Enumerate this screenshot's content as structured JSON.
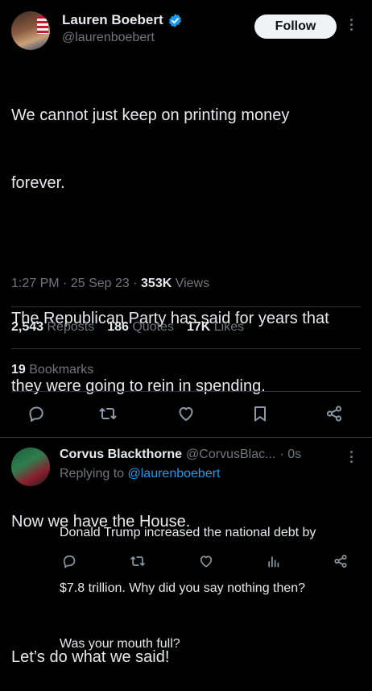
{
  "tweet": {
    "author_name": "Lauren Boebert",
    "author_handle": "@laurenboebert",
    "follow_label": "Follow",
    "lines": [
      "We cannot just keep on printing money",
      "forever.",
      "The Republican Party has said for years that",
      "they were going to rein in spending.",
      "Now we have the House.",
      "Let’s do what we said!"
    ],
    "time": "1:27 PM",
    "date": "25 Sep 23",
    "views_count": "353K",
    "views_label": "Views",
    "reposts_count": "2,543",
    "reposts_label": "Reposts",
    "quotes_count": "186",
    "quotes_label": "Quotes",
    "likes_count": "17K",
    "likes_label": "Likes",
    "bookmarks_count": "19",
    "bookmarks_label": "Bookmarks"
  },
  "reply": {
    "author_name": "Corvus Blackthorne",
    "author_handle": "@CorvusBlac...",
    "age": "· 0s",
    "replying_prefix": "Replying to",
    "replying_handle": "@laurenboebert",
    "lines": [
      "Donald Trump increased the national debt by",
      "$7.8 trillion. Why did you say nothing then?",
      "Was your mouth full?"
    ]
  },
  "colors": {
    "background": "#000000",
    "text": "#e7e9ea",
    "muted": "#71767b",
    "accent": "#1d9bf0",
    "divider": "#2f3336"
  },
  "icons": [
    "verified-badge-icon",
    "more-icon",
    "reply-icon",
    "repost-icon",
    "like-icon",
    "bookmark-icon",
    "share-icon",
    "analytics-icon"
  ]
}
